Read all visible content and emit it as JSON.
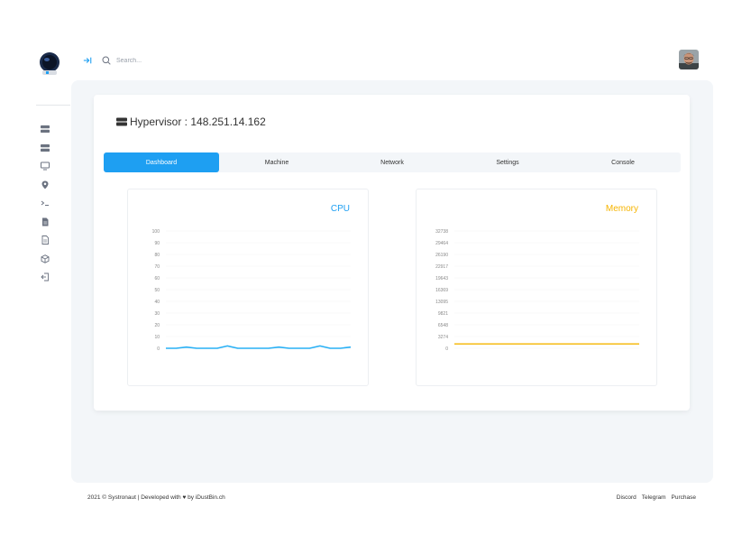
{
  "search": {
    "placeholder": "Search..."
  },
  "sidebar": {
    "items": [
      {
        "icon": "server-icon"
      },
      {
        "icon": "server-icon"
      },
      {
        "icon": "monitor-icon"
      },
      {
        "icon": "map-pin-icon"
      },
      {
        "icon": "terminal-icon"
      },
      {
        "icon": "file-filled-icon"
      },
      {
        "icon": "file-outline-icon"
      },
      {
        "icon": "box-icon"
      },
      {
        "icon": "logout-icon"
      }
    ]
  },
  "page": {
    "title": "Hypervisor : 148.251.14.162"
  },
  "tabs": [
    {
      "label": "Dashboard",
      "active": true
    },
    {
      "label": "Machine",
      "active": false
    },
    {
      "label": "Network",
      "active": false
    },
    {
      "label": "Settings",
      "active": false
    },
    {
      "label": "Console",
      "active": false
    }
  ],
  "chart_data": [
    {
      "type": "line",
      "title": "CPU",
      "title_color": "#1e9ff2",
      "line_color": "#29b0f5",
      "yticks": [
        100,
        90,
        80,
        70,
        60,
        50,
        40,
        30,
        20,
        10,
        0
      ],
      "ylim": [
        0,
        100
      ],
      "values": [
        0,
        0,
        1,
        0,
        0,
        0,
        2,
        0,
        0,
        0,
        0,
        1,
        0,
        0,
        0,
        2,
        0,
        0,
        1
      ]
    },
    {
      "type": "line",
      "title": "Memory",
      "title_color": "#f6b400",
      "line_color": "#f6c026",
      "yticks": [
        32738,
        29464,
        26190,
        22917,
        19643,
        16369,
        13095,
        9821,
        6548,
        3274,
        0
      ],
      "ylim": [
        0,
        32738
      ],
      "values": [
        1200,
        1200,
        1200,
        1200,
        1200,
        1200,
        1200,
        1200,
        1200,
        1200,
        1200
      ]
    }
  ],
  "footer": {
    "copyright": "2021 © Systronaut | Developed with",
    "byline": "by iDustBin.ch",
    "links": [
      "Discord",
      "Telegram",
      "Purchase"
    ]
  }
}
